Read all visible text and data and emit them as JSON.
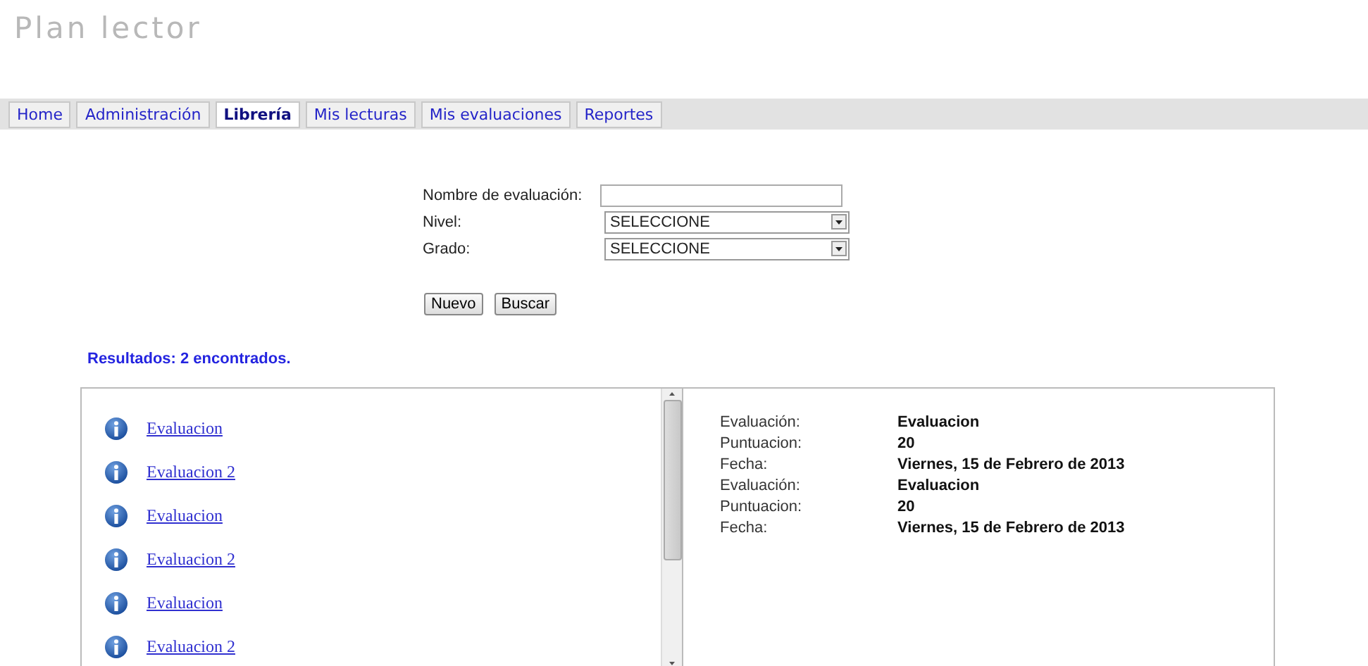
{
  "title": "Plan lector",
  "tabs": [
    {
      "label": "Home",
      "selected": false
    },
    {
      "label": "Administración",
      "selected": false
    },
    {
      "label": "Librería",
      "selected": true
    },
    {
      "label": "Mis lecturas",
      "selected": false
    },
    {
      "label": "Mis evaluaciones",
      "selected": false
    },
    {
      "label": "Reportes",
      "selected": false
    }
  ],
  "form": {
    "fields": [
      {
        "label": "Nombre de evaluación:",
        "kind": "text"
      },
      {
        "label": "Nivel:",
        "kind": "select",
        "value": "SELECCIONE"
      },
      {
        "label": "Grado:",
        "kind": "select",
        "value": "SELECCIONE"
      }
    ],
    "buttons": [
      "Nuevo",
      "Buscar"
    ]
  },
  "results_summary": "Resultados: 2 encontrados.",
  "results": [
    "Evaluacion",
    "Evaluacion 2",
    "Evaluacion",
    "Evaluacion 2",
    "Evaluacion",
    "Evaluacion 2"
  ],
  "details": [
    {
      "label": "Evaluación:",
      "value": "Evaluacion"
    },
    {
      "label": "Puntuacion:",
      "value": "20"
    },
    {
      "label": "Fecha:",
      "value": "Viernes, 15 de Febrero de 2013"
    },
    {
      "label": "Evaluación:",
      "value": "Evaluacion"
    },
    {
      "label": "Puntuacion:",
      "value": "20"
    },
    {
      "label": "Fecha:",
      "value": "Viernes, 15 de Febrero de 2013"
    }
  ]
}
